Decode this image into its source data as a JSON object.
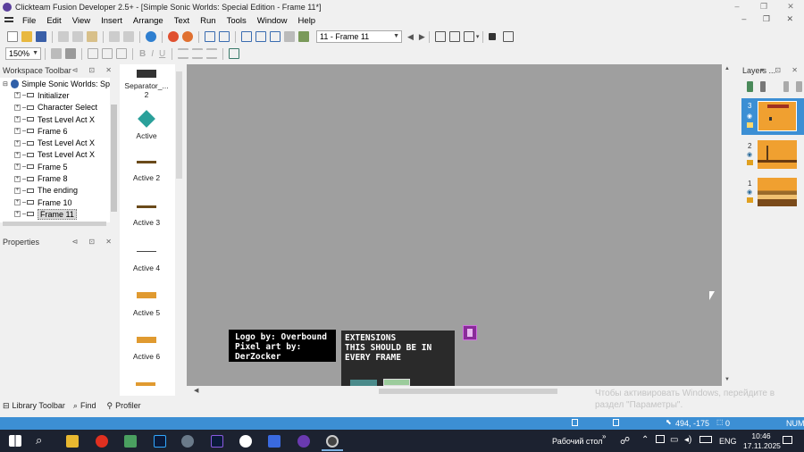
{
  "window": {
    "title": "Clickteam Fusion Developer 2.5+ - [Simple Sonic Worlds: Special Edition - Frame 11*]",
    "controls": [
      "–",
      "❐",
      "✕"
    ],
    "mdi_controls": "– ❐ ✕"
  },
  "menu": [
    "File",
    "Edit",
    "View",
    "Insert",
    "Arrange",
    "Text",
    "Run",
    "Tools",
    "Window",
    "Help"
  ],
  "toolbar": {
    "frame_select": "11 - Frame 11",
    "zoom": "150%"
  },
  "workspace": {
    "title": "Workspace Toolbar",
    "root": "Simple Sonic Worlds: Sp",
    "frames": [
      "Initializer",
      "Character Select",
      "Test Level Act X",
      "Frame 6",
      "Test Level Act X",
      "Test Level Act X",
      "Frame 5",
      "Frame 8",
      "The ending",
      "Frame 10",
      "Frame 11"
    ],
    "selected_index": 10
  },
  "properties": {
    "title": "Properties"
  },
  "objects": [
    {
      "label": "Separator_...\n2",
      "icon": "separator-object-icon"
    },
    {
      "label": "Active",
      "icon": "diamond-active-icon"
    },
    {
      "label": "Active 2",
      "icon": "platform-bar-icon"
    },
    {
      "label": "Active 3",
      "icon": "platform-bar-icon"
    },
    {
      "label": "Active 4",
      "icon": "thin-line-icon"
    },
    {
      "label": "Active 5",
      "icon": "orange-block-icon"
    },
    {
      "label": "Active 6",
      "icon": "orange-block-icon"
    }
  ],
  "canvas": {
    "credit_line1": "Logo by: Overbound",
    "credit_line2": "Pixel art by: DerZocker",
    "ext_line1": "EXTENSIONS",
    "ext_line2": "THIS SHOULD BE IN",
    "ext_line3": "EVERY FRAME",
    "background_color": "#9f9f9f"
  },
  "layers": {
    "title": "Layers ...",
    "items": [
      {
        "number": "3",
        "selected": true
      },
      {
        "number": "2",
        "selected": false
      },
      {
        "number": "1",
        "selected": false
      }
    ]
  },
  "bottom_tabs": [
    "Library Toolbar",
    "Find",
    "Profiler"
  ],
  "statusbar": {
    "coords": "494, -175",
    "count": "0",
    "num": "NUM"
  },
  "watermark": {
    "line1": "Чтобы активировать Windows, перейдите в",
    "line2": "раздел \"Параметры\"."
  },
  "taskbar": {
    "desktop_label": "Рабочий стол",
    "lang": "ENG",
    "time": "10:46",
    "date": "17.11.2025"
  },
  "colors": {
    "accent_blue": "#3c8fd4",
    "statusbar": "#3c8fd4",
    "taskbar": "#1c2230",
    "orange": "#f0a030"
  }
}
